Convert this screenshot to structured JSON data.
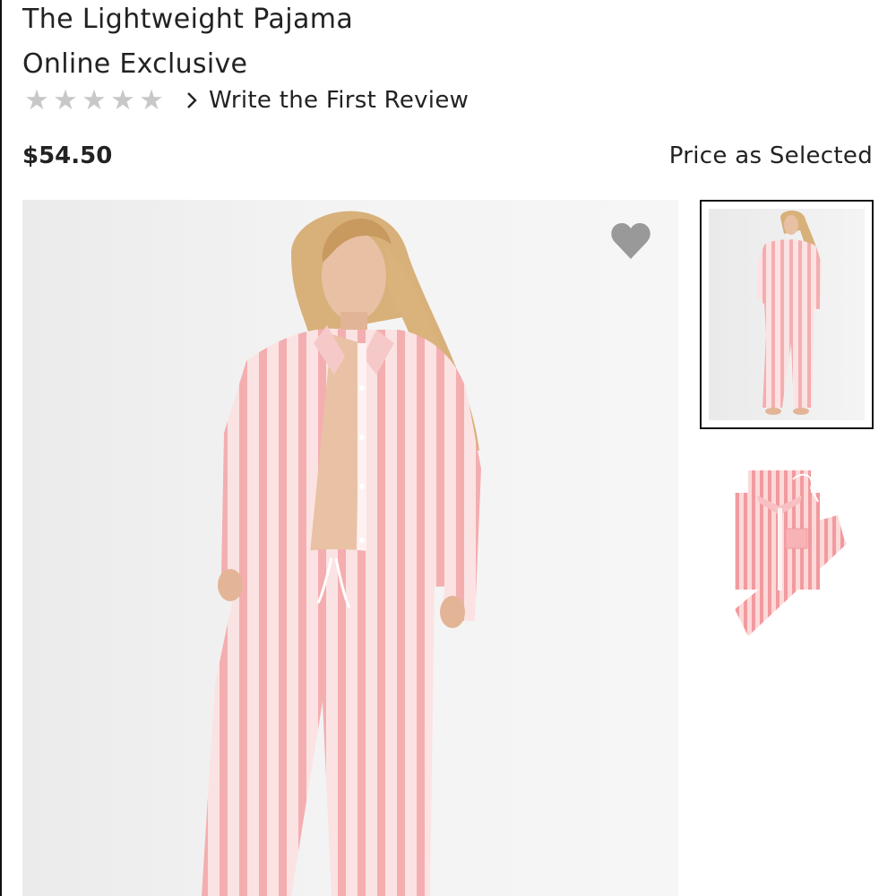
{
  "product": {
    "title": "The Lightweight Pajama",
    "subtitle": "Online Exclusive",
    "rating": {
      "stars": 0,
      "max": 5,
      "review_link_label": "Write the First Review"
    },
    "price": "$54.50",
    "price_note": "Price as Selected"
  },
  "icons": {
    "stars": "star-icon",
    "chevron": "chevron-right-icon",
    "favorite": "heart-icon"
  },
  "colors": {
    "text": "#222222",
    "star_empty": "#c8c8c8",
    "heart": "#999999",
    "pajama_pink": "#f4aeb0",
    "selected_border": "#111111"
  }
}
